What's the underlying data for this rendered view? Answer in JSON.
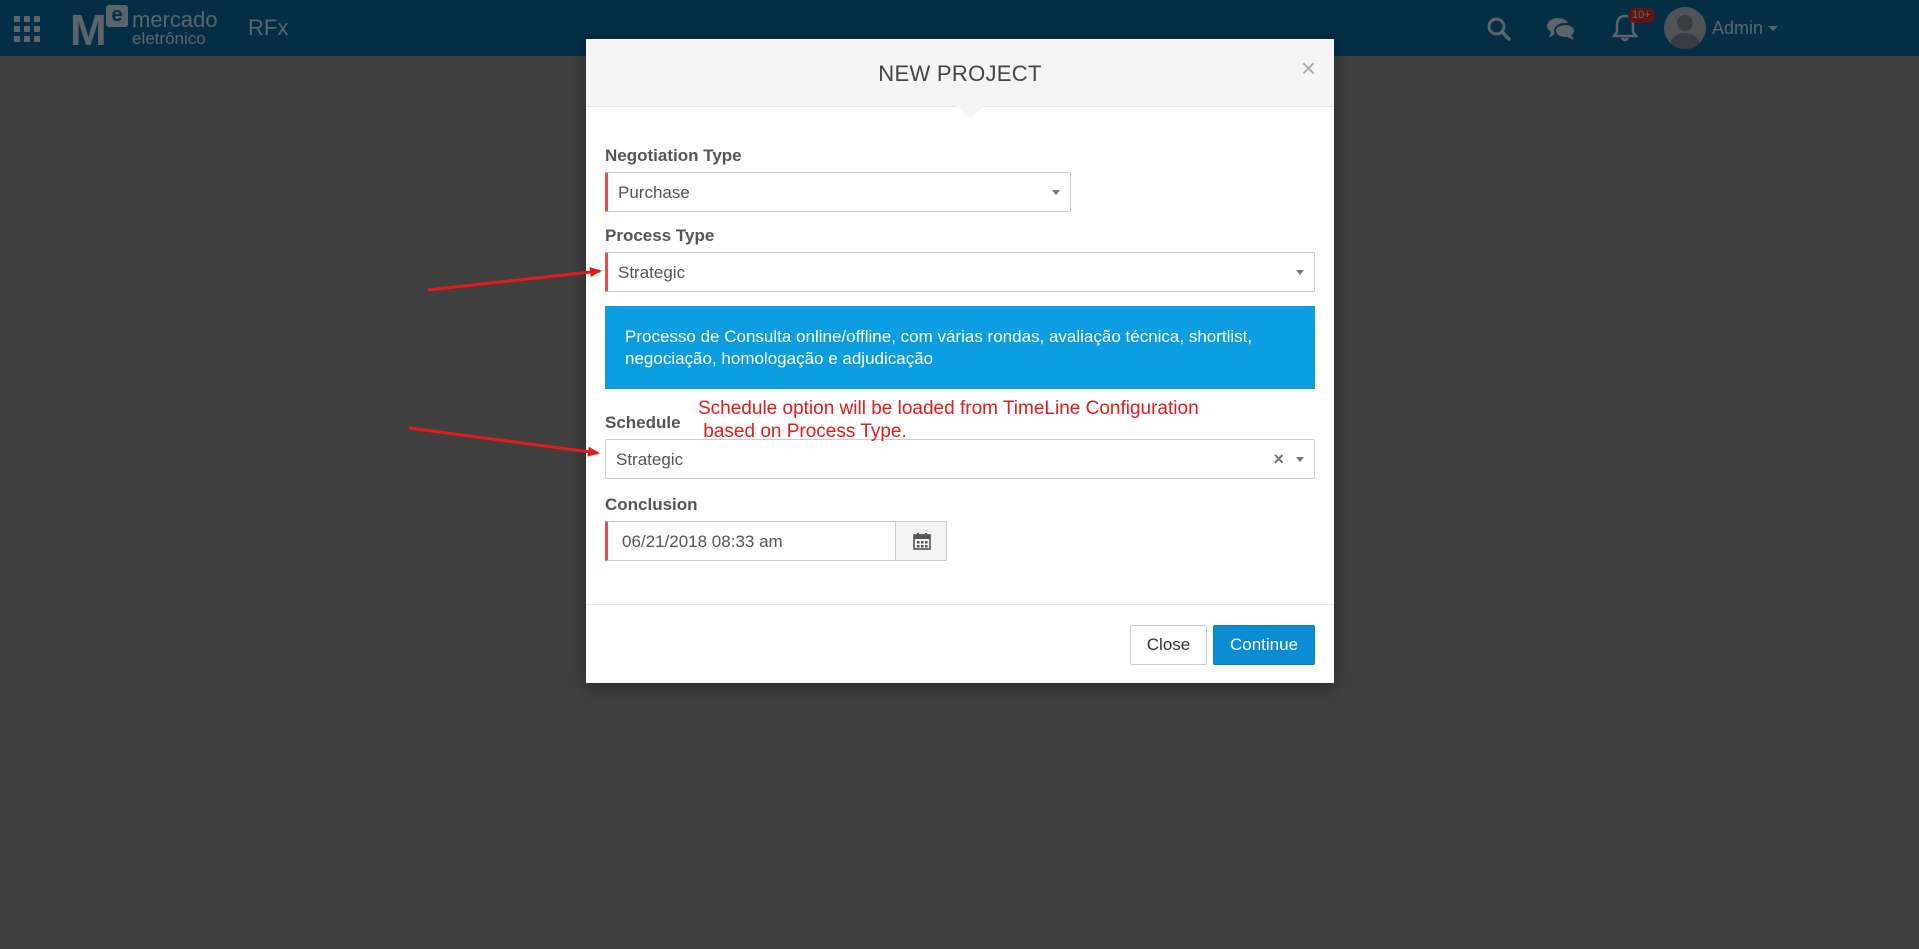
{
  "topbar": {
    "logo_line1": "mercado",
    "logo_line2": "eletrônico",
    "logo_mark": "M",
    "logo_mark_e": "e",
    "app_name": "RFx",
    "notification_count": "10+",
    "user_name": "Admin",
    "icons": [
      "apps-grid-icon",
      "search-icon",
      "chat-icon",
      "bell-icon",
      "avatar",
      "chevron-down-icon"
    ]
  },
  "modal": {
    "title": "NEW PROJECT",
    "close_glyph": "×",
    "negotiation_type": {
      "label": "Negotiation Type",
      "value": "Purchase"
    },
    "process_type": {
      "label": "Process Type",
      "value": "Strategic"
    },
    "info_text": "Processo de Consulta online/offline, com várias rondas, avaliação técnica, shortlist, negociação, homologação e adjudicação",
    "schedule": {
      "label": "Schedule",
      "value": "Strategic",
      "clear_glyph": "×"
    },
    "conclusion": {
      "label": "Conclusion",
      "value": "06/21/2018 08:33 am"
    },
    "footer": {
      "close_label": "Close",
      "continue_label": "Continue"
    }
  },
  "annotation": {
    "text": "Schedule option will be loaded from TimeLine Configuration\n based on Process Type.",
    "color": "#e31b1b"
  },
  "colors": {
    "topbar": "#0a5c8a",
    "primary_button": "#0c8dd3",
    "info_box": "#0c9ee0",
    "required_marker": "#e84c4c"
  }
}
